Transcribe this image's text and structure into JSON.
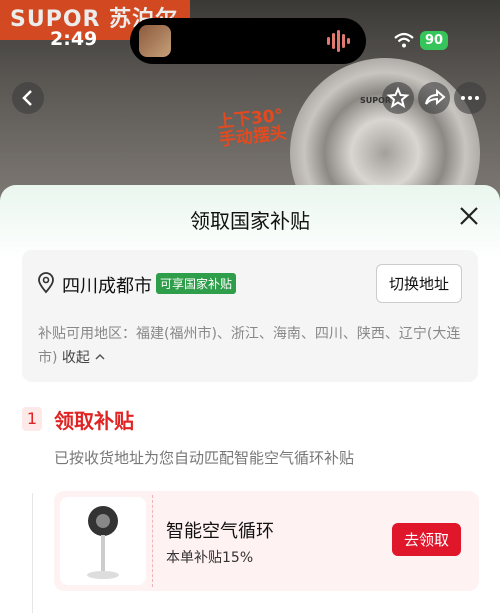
{
  "status_bar": {
    "time": "2:49",
    "battery": "90"
  },
  "background": {
    "brand": "SUPOR 苏泊尔",
    "fan_brand": "SUPOR",
    "promo_line1": "上下30°",
    "promo_line2": "手动摆头"
  },
  "sheet": {
    "title": "领取国家补贴",
    "address": {
      "city": "四川成都市",
      "tag": "可享国家补贴",
      "switch_label": "切换地址",
      "areas_text": "补贴可用地区：福建(福州市)、浙江、海南、四川、陕西、辽宁(大连市)",
      "collapse_label": "收起"
    },
    "step": {
      "number": "1",
      "title": "领取补贴",
      "description": "已按收货地址为您自动匹配智能空气循环补贴"
    },
    "coupon": {
      "name": "智能空气循环",
      "subsidy": "本单补贴15%",
      "claim_label": "去领取"
    }
  },
  "colors": {
    "accent_red": "#e0162b",
    "tag_green": "#2f9e4a",
    "battery_green": "#36c55a"
  }
}
